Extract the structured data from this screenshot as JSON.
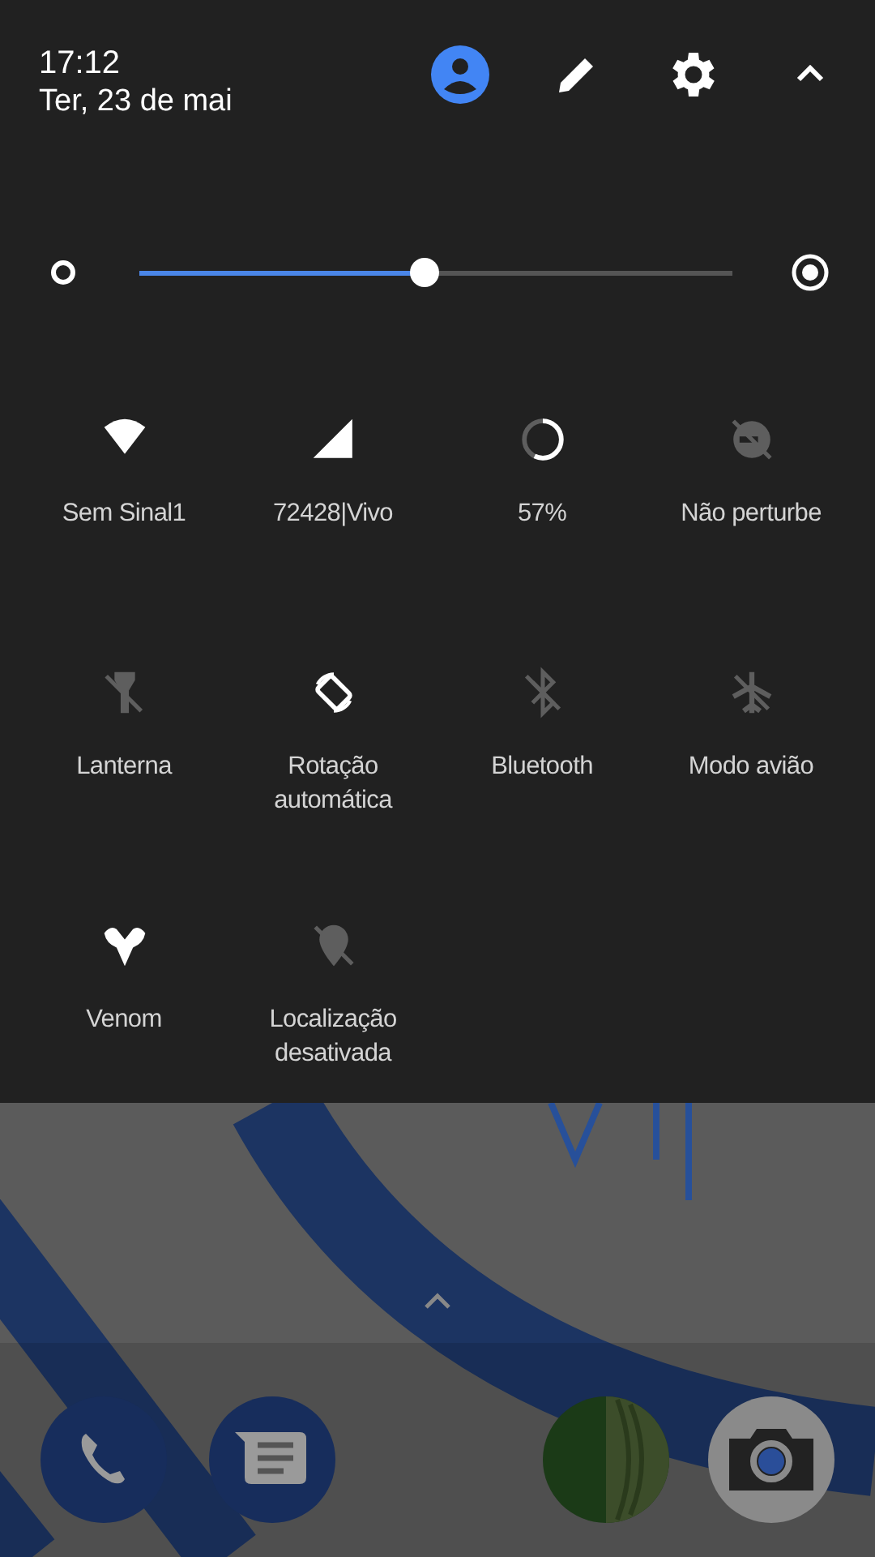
{
  "header": {
    "time": "17:12",
    "date": "Ter, 23 de mai"
  },
  "brightness": {
    "level": 0.48
  },
  "tiles": [
    {
      "label": "Sem Sinal1",
      "on": true
    },
    {
      "label": "72428|Vivo",
      "on": true
    },
    {
      "label": "57%",
      "on": true,
      "level": 0.57
    },
    {
      "label": "Não perturbe",
      "on": false
    },
    {
      "label": "Lanterna",
      "on": false
    },
    {
      "label": "Rotação automática",
      "on": true
    },
    {
      "label": "Bluetooth",
      "on": false
    },
    {
      "label": "Modo avião",
      "on": false
    },
    {
      "label": "Venom",
      "on": true
    },
    {
      "label": "Localização desativada",
      "on": false
    }
  ]
}
